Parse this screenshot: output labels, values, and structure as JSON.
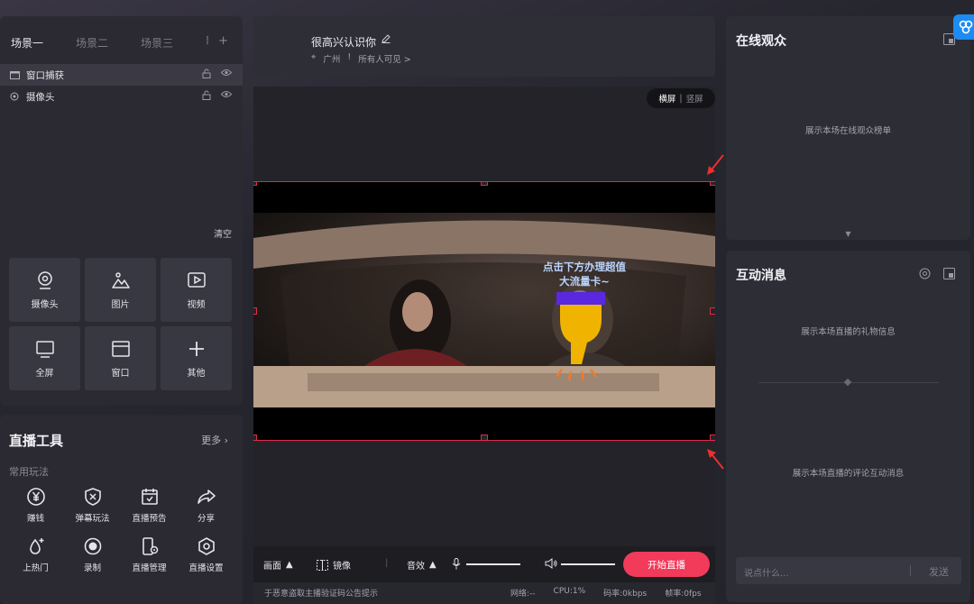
{
  "scenes": {
    "tabs": [
      "场景一",
      "场景二",
      "场景三"
    ],
    "active_index": 0
  },
  "sources": [
    {
      "label": "窗口捕获",
      "icon": "window-capture-icon"
    },
    {
      "label": "摄像头",
      "icon": "camera-icon"
    }
  ],
  "clear_label": "清空",
  "add_sources": [
    {
      "label": "摄像头",
      "icon": "webcam-icon"
    },
    {
      "label": "图片",
      "icon": "image-icon"
    },
    {
      "label": "视频",
      "icon": "video-icon"
    },
    {
      "label": "全屏",
      "icon": "monitor-icon"
    },
    {
      "label": "窗口",
      "icon": "window-icon"
    },
    {
      "label": "其他",
      "icon": "plus-icon"
    }
  ],
  "live_tools": {
    "title": "直播工具",
    "more_label": "更多",
    "section_label": "常用玩法",
    "items": [
      {
        "label": "赚钱",
        "icon": "yen-coin-icon"
      },
      {
        "label": "弹幕玩法",
        "icon": "shield-x-icon"
      },
      {
        "label": "直播预告",
        "icon": "calendar-icon"
      },
      {
        "label": "分享",
        "icon": "share-arrow-icon"
      },
      {
        "label": "上热门",
        "icon": "flame-plus-icon"
      },
      {
        "label": "录制",
        "icon": "record-icon"
      },
      {
        "label": "直播管理",
        "icon": "device-settings-icon"
      },
      {
        "label": "直播设置",
        "icon": "hexagon-settings-icon"
      }
    ]
  },
  "room": {
    "title": "很高兴认识你",
    "location": "广州",
    "visibility": "所有人可见 >"
  },
  "orientation": {
    "landscape": "横屏",
    "portrait": "竖屏",
    "active": "横屏"
  },
  "overlay": {
    "line1": "点击下方办理超值",
    "line2": "大流量卡~"
  },
  "bottom_bar": {
    "picture_label": "画面",
    "mirror_label": "镜像",
    "sound_effect_label": "音效",
    "start_label": "开始直播",
    "mic_level": 1.0,
    "volume_level": 1.0
  },
  "status": {
    "notice": "于恶意盗取主播验证码公告提示",
    "network": "网络:--",
    "cpu": "CPU:1%",
    "bitrate": "码率:0kbps",
    "framerate": "帧率:0fps"
  },
  "audience": {
    "title": "在线观众",
    "empty_text": "展示本场在线观众榜单"
  },
  "messages": {
    "title": "互动消息",
    "gift_empty": "展示本场直播的礼物信息",
    "comment_empty": "展示本场直播的评论互动消息",
    "input_placeholder": "说点什么...",
    "send_label": "发送"
  },
  "colors": {
    "accent": "#f23a5b",
    "selection_border": "#e0294a",
    "overlay_text": "#b9d4ff",
    "corner_badge": "#1c8cf2"
  }
}
